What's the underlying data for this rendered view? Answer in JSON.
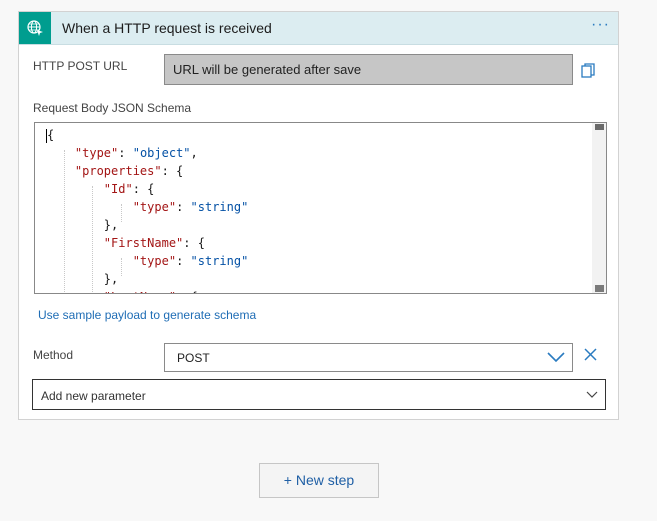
{
  "trigger": {
    "icon": "globe-request-icon",
    "title": "When a HTTP request is received",
    "more_label": "···"
  },
  "http_post_url": {
    "label": "HTTP POST URL",
    "value": "URL will be generated after save",
    "copy_icon": "copy-icon"
  },
  "schema": {
    "label": "Request Body JSON Schema",
    "lines": [
      "{",
      "    \"type\": \"object\",",
      "    \"properties\": {",
      "        \"Id\": {",
      "            \"type\": \"string\"",
      "        },",
      "        \"FirstName\": {",
      "            \"type\": \"string\"",
      "        },",
      "        \"LastName\": {"
    ]
  },
  "sample_link": "Use sample payload to generate schema",
  "method": {
    "label": "Method",
    "value": "POST",
    "dropdown_icon": "chevron-down-icon",
    "remove_icon": "close-icon"
  },
  "add_parameter": {
    "placeholder": "Add new parameter",
    "dropdown_icon": "chevron-down-icon"
  },
  "new_step": "+ New step",
  "colors": {
    "trigger_accent": "#009d8f",
    "header_bg": "#dcedf1",
    "link": "#1f6db5",
    "json_key": "#a31515",
    "json_string": "#0451a5"
  }
}
